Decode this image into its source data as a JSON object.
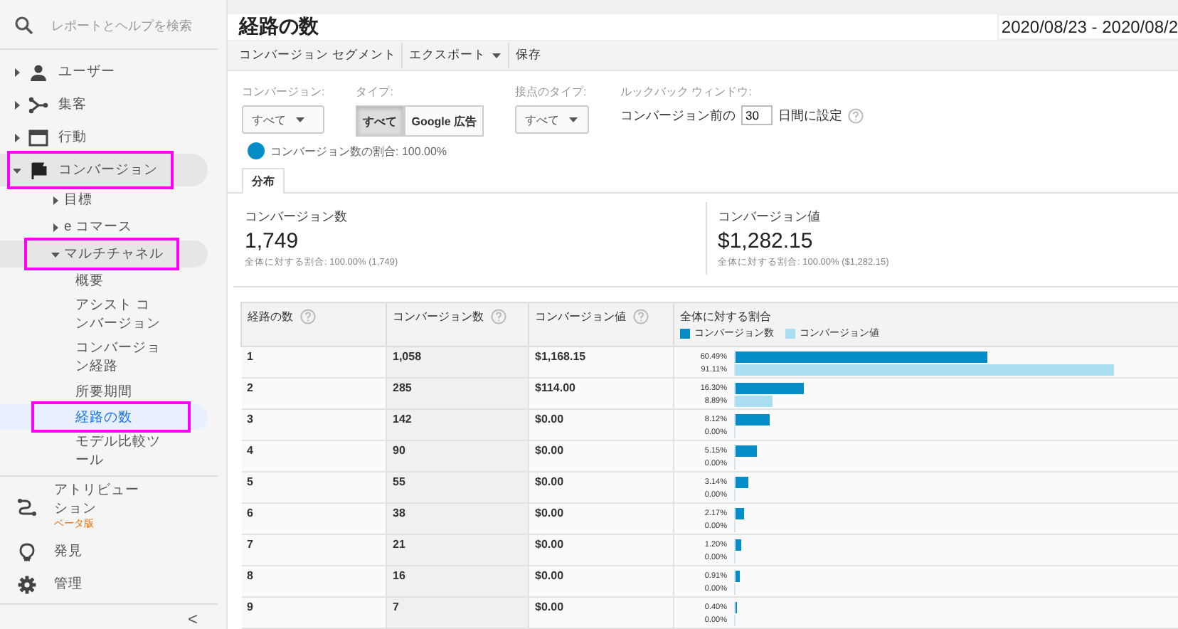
{
  "sidebar": {
    "search": {
      "placeholder": "レポートとヘルプを検索"
    },
    "items": [
      {
        "label": "ユーザー",
        "expanded": false
      },
      {
        "label": "集客",
        "expanded": false
      },
      {
        "label": "行動",
        "expanded": false
      },
      {
        "label": "コンバージョン",
        "expanded": true,
        "highlighted": true,
        "children": [
          {
            "label": "目標",
            "expanded": false
          },
          {
            "label": "e コマース",
            "expanded": false
          },
          {
            "label": "マルチチャネル",
            "expanded": true,
            "highlighted": true,
            "children": [
              {
                "label": "概要",
                "selected": false
              },
              {
                "label": "アシスト コンバージョン",
                "selected": false
              },
              {
                "label": "コンバージョン経路",
                "selected": false
              },
              {
                "label": "所要期間",
                "selected": false
              },
              {
                "label": "経路の数",
                "selected": true,
                "highlighted": true
              },
              {
                "label": "モデル比較ツール",
                "selected": false
              }
            ]
          }
        ]
      }
    ],
    "tools": [
      {
        "label": "アトリビューション",
        "badge": "ベータ版"
      },
      {
        "label": "発見"
      },
      {
        "label": "管理"
      }
    ],
    "collapse": "<"
  },
  "report": {
    "title": "経路の数",
    "date_range": "2020/08/23 - 2020/08/2",
    "toolbar": [
      {
        "label": "コンバージョン セグメント",
        "menu": false
      },
      {
        "label": "エクスポート",
        "menu": true
      },
      {
        "label": "保存",
        "menu": false
      }
    ],
    "filters": [
      {
        "kind": "dropdown",
        "label": "コンバージョン:",
        "value": "すべて"
      },
      {
        "kind": "segmented",
        "label": "タイプ:",
        "options": [
          {
            "label": "すべて",
            "selected": true
          },
          {
            "label": "Google 広告",
            "selected": false
          }
        ]
      },
      {
        "kind": "dropdown",
        "label": "接点のタイプ:",
        "value": "すべて"
      },
      {
        "kind": "lookback",
        "label": "ルックバック ウィンドウ:",
        "prefix": "コンバージョン前の",
        "value": "30",
        "suffix": "日間に設定"
      }
    ],
    "segment": {
      "label": "コンバージョン数の割合: 100.00%",
      "color": "#058dc7"
    },
    "tabs": [
      {
        "label": "分布",
        "selected": true
      }
    ],
    "scorecards": [
      {
        "title": "コンバージョン数",
        "value": "1,749",
        "sub": "全体に対する割合: 100.00% (1,749)"
      },
      {
        "title": "コンバージョン値",
        "value": "$1,282.15",
        "sub": "全体に対する割合: 100.00% ($1,282.15)"
      }
    ],
    "table": {
      "columns": [
        {
          "label": "経路の数"
        },
        {
          "label": "コンバージョン数"
        },
        {
          "label": "コンバージョン値"
        },
        {
          "label": "全体に対する割合"
        }
      ],
      "legend": [
        {
          "label": "コンバージョン数",
          "color": "#058dc7"
        },
        {
          "label": "コンバージョン値",
          "color": "#aadff3"
        }
      ],
      "rows": [
        {
          "paths": "1",
          "conversions": "1,058",
          "value": "$1,168.15",
          "share": [
            {
              "text": "60.49%",
              "level": 0.6049
            },
            {
              "text": "91.11%",
              "level": 0.9111
            }
          ]
        },
        {
          "paths": "2",
          "conversions": "285",
          "value": "$114.00",
          "share": [
            {
              "text": "16.30%",
              "level": 0.163
            },
            {
              "text": "8.89%",
              "level": 0.0889
            }
          ]
        },
        {
          "paths": "3",
          "conversions": "142",
          "value": "$0.00",
          "share": [
            {
              "text": "8.12%",
              "level": 0.0812
            },
            {
              "text": "0.00%",
              "level": 0
            }
          ]
        },
        {
          "paths": "4",
          "conversions": "90",
          "value": "$0.00",
          "share": [
            {
              "text": "5.15%",
              "level": 0.0515
            },
            {
              "text": "0.00%",
              "level": 0
            }
          ]
        },
        {
          "paths": "5",
          "conversions": "55",
          "value": "$0.00",
          "share": [
            {
              "text": "3.14%",
              "level": 0.0314
            },
            {
              "text": "0.00%",
              "level": 0
            }
          ]
        },
        {
          "paths": "6",
          "conversions": "38",
          "value": "$0.00",
          "share": [
            {
              "text": "2.17%",
              "level": 0.0217
            },
            {
              "text": "0.00%",
              "level": 0
            }
          ]
        },
        {
          "paths": "7",
          "conversions": "21",
          "value": "$0.00",
          "share": [
            {
              "text": "1.20%",
              "level": 0.012
            },
            {
              "text": "0.00%",
              "level": 0
            }
          ]
        },
        {
          "paths": "8",
          "conversions": "16",
          "value": "$0.00",
          "share": [
            {
              "text": "0.91%",
              "level": 0.0091
            },
            {
              "text": "0.00%",
              "level": 0
            }
          ]
        },
        {
          "paths": "9",
          "conversions": "7",
          "value": "$0.00",
          "share": [
            {
              "text": "0.40%",
              "level": 0.004
            },
            {
              "text": "0.00%",
              "level": 0
            }
          ]
        }
      ]
    }
  }
}
